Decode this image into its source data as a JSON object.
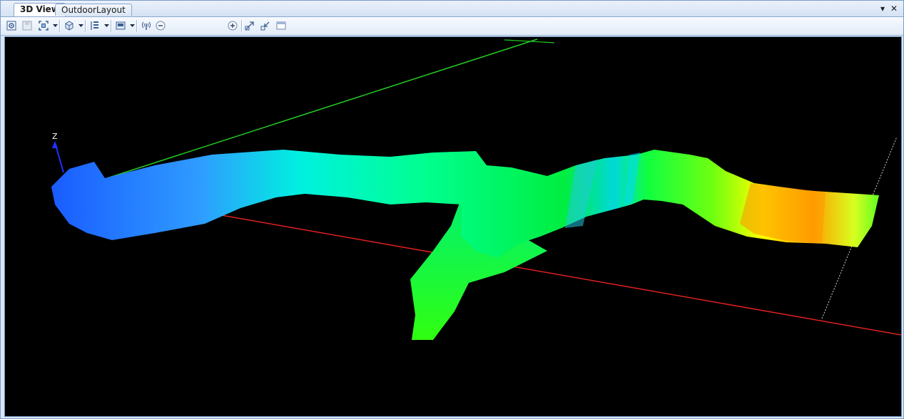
{
  "tabs": [
    {
      "label": "3D View",
      "active": true
    },
    {
      "label": "OutdoorLayout",
      "active": false
    }
  ],
  "window_controls": {
    "dropdown": "▾",
    "close": "✕"
  },
  "toolbar": {
    "icons": [
      "camera-icon",
      "save-image-icon",
      "fit-view-icon",
      "view-cube-icon",
      "layers-icon",
      "render-mode-icon",
      "antenna-icon",
      "zoom-out-icon",
      "zoom-in-icon",
      "expand-icon",
      "shrink-icon",
      "window-icon"
    ]
  },
  "viewport": {
    "background": "#000000",
    "axis_z_label": "Z",
    "colors": {
      "x_axis": "#e02020",
      "y_axis": "#22cc22",
      "z_axis": "#2030ff",
      "low": "#1a5cff",
      "mid": "#00ff80",
      "high": "#ff9900"
    }
  }
}
